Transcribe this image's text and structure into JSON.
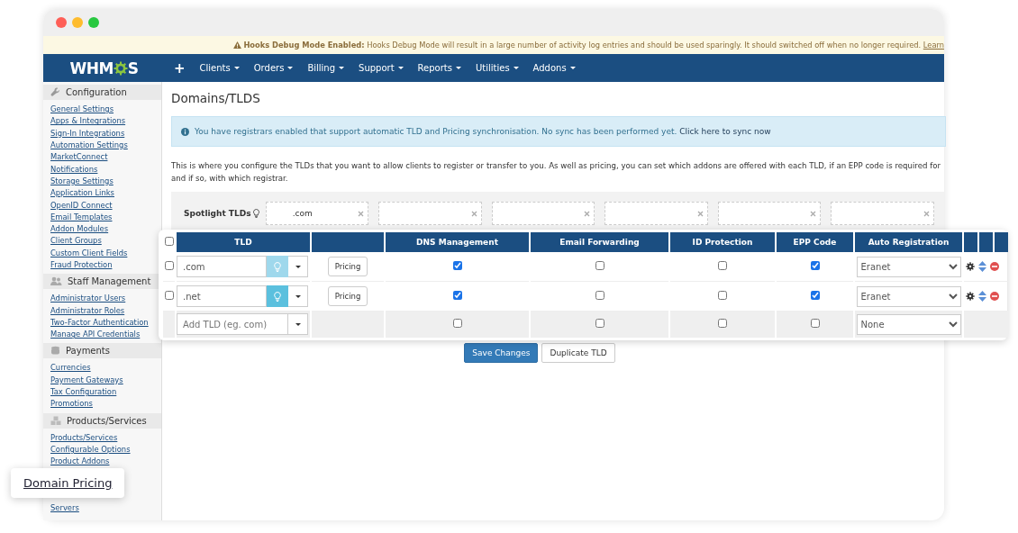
{
  "debug_banner": {
    "title": "Hooks Debug Mode Enabled:",
    "message": "Hooks Debug Mode will result in a large number of activity log entries and should be used sparingly. It should switched off when no longer required.",
    "link": "Learn"
  },
  "nav": {
    "logo": [
      "WHM",
      "S"
    ],
    "add": "+",
    "items": [
      "Clients",
      "Orders",
      "Billing",
      "Support",
      "Reports",
      "Utilities",
      "Addons"
    ]
  },
  "sidebar": {
    "sections": [
      {
        "title": "Configuration",
        "items": [
          "General Settings",
          "Apps & Integrations",
          "Sign-In Integrations",
          "Automation Settings",
          "MarketConnect",
          "Notifications",
          "Storage Settings",
          "Application Links",
          "OpenID Connect",
          "Email Templates",
          "Addon Modules",
          "Client Groups",
          "Custom Client Fields",
          "Fraud Protection"
        ]
      },
      {
        "title": "Staff Management",
        "items": [
          "Administrator Users",
          "Administrator Roles",
          "Two-Factor Authentication",
          "Manage API Credentials"
        ]
      },
      {
        "title": "Payments",
        "items": [
          "Currencies",
          "Payment Gateways",
          "Tax Configuration",
          "Promotions"
        ]
      },
      {
        "title": "Products/Services",
        "items": [
          "Products/Services",
          "Configurable Options",
          "Product Addons",
          "Servers"
        ]
      }
    ]
  },
  "main": {
    "title": "Domains/TLDS",
    "alert": {
      "text": "You have registrars enabled that support automatic TLD and Pricing synchronisation. No sync has been performed yet.",
      "link": "Click here to sync now"
    },
    "description": "This is where you configure the TLDs that you want to allow clients to register or transfer to you. As well as pricing, you can set which addons are offered with each TLD, if an EPP code is required for and if so, with which registrar.",
    "spotlight": {
      "label": "Spotlight TLDs",
      "fields": [
        {
          "kind": "filled",
          "value": ".com"
        },
        {
          "kind": "empty"
        },
        {
          "kind": "empty"
        },
        {
          "kind": "empty"
        },
        {
          "kind": "empty"
        },
        {
          "kind": "empty"
        }
      ]
    }
  },
  "table": {
    "select_all": {
      "checked": false
    },
    "columns": [
      "TLD",
      "DNS Management",
      "Email Forwarding",
      "ID Protection",
      "EPP Code",
      "Auto Registration"
    ],
    "rows": [
      {
        "tld": ".com",
        "checked": false,
        "spotlight_active": false,
        "pricing": "Pricing",
        "dns": true,
        "email": false,
        "id_protection": false,
        "epp": true,
        "registrar": "Eranet"
      },
      {
        "tld": ".net",
        "checked": false,
        "spotlight_active": true,
        "pricing": "Pricing",
        "dns": true,
        "email": false,
        "id_protection": false,
        "epp": true,
        "registrar": "Eranet"
      }
    ],
    "new_row": {
      "placeholder": "Add TLD (eg. com)",
      "dns": false,
      "email": false,
      "id_protection": false,
      "epp": false,
      "registrar": "None"
    }
  },
  "buttons": [
    "Save Changes",
    "Duplicate TLD"
  ],
  "tooltip": "Domain Pricing"
}
